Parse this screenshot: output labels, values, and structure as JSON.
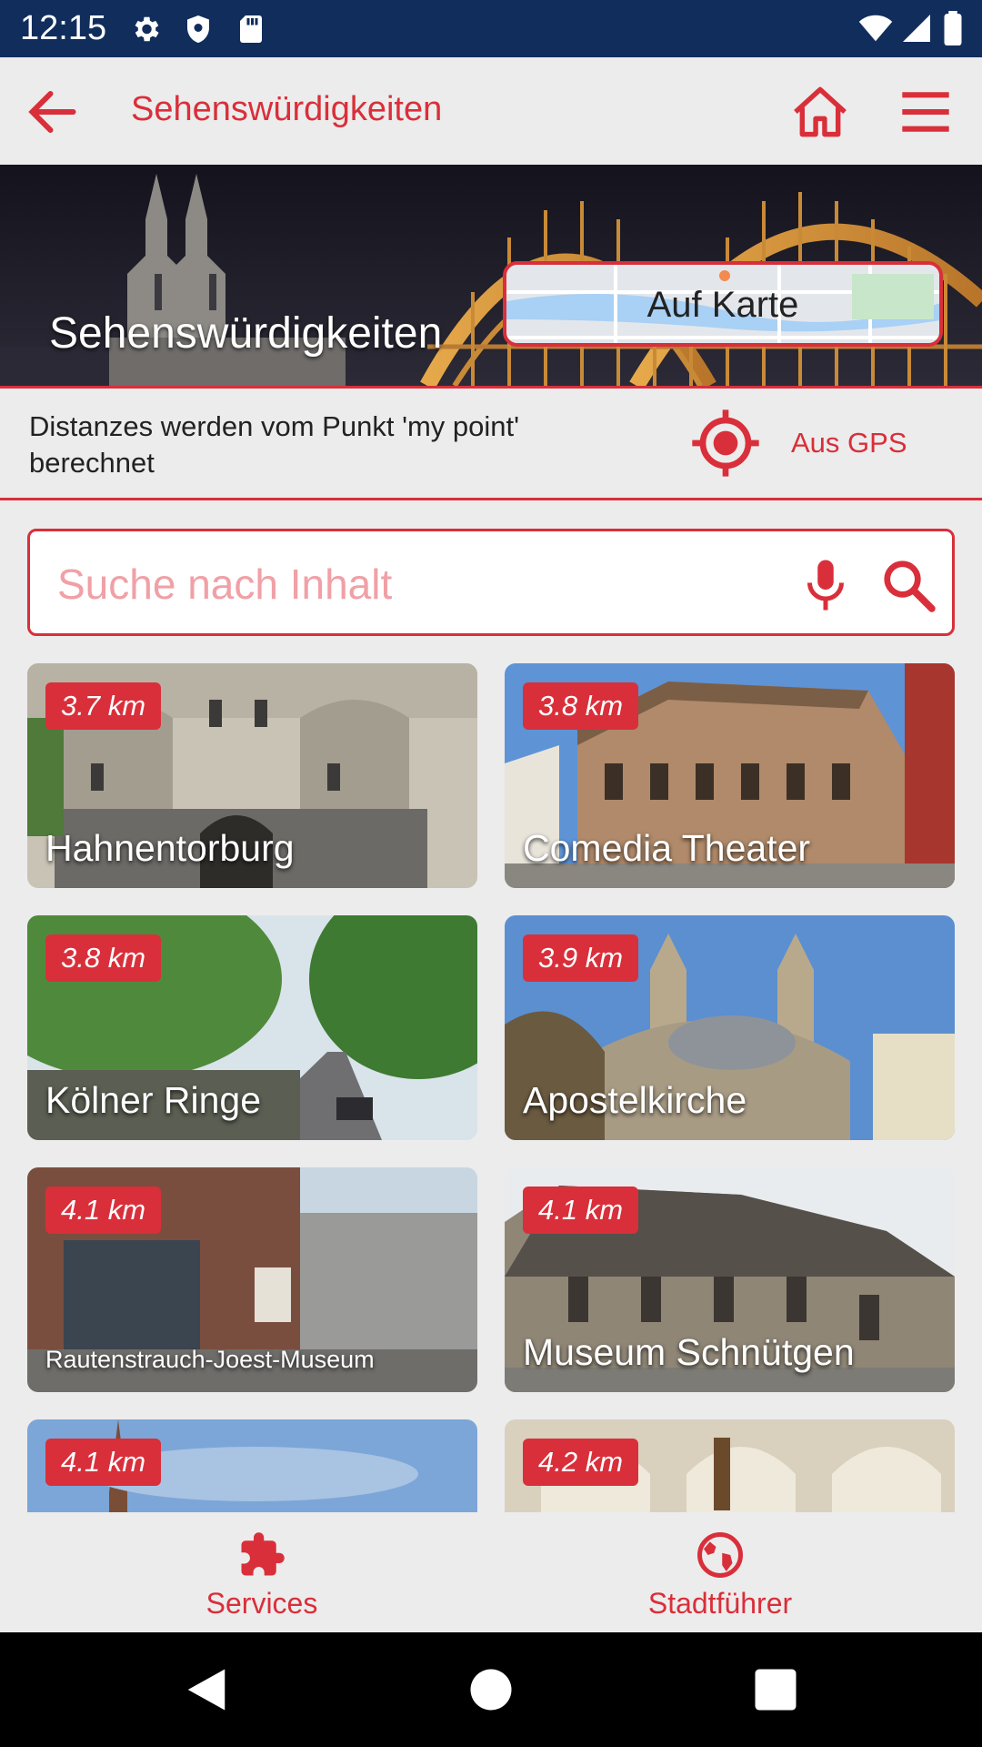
{
  "status_bar": {
    "time": "12:15"
  },
  "app_bar": {
    "title": "Sehenswürdigkeiten"
  },
  "hero": {
    "title": "Sehenswürdigkeiten",
    "map_button_label": "Auf Karte"
  },
  "info": {
    "distance_text": "Distanzes werden vom Punkt 'my point' berechnet",
    "gps_label": "Aus GPS"
  },
  "search": {
    "placeholder": "Suche nach Inhalt",
    "value": ""
  },
  "cards": [
    {
      "distance": "3.7 km",
      "name": "Hahnentorburg"
    },
    {
      "distance": "3.8 km",
      "name": "Comedia Theater"
    },
    {
      "distance": "3.8 km",
      "name": "Kölner Ringe"
    },
    {
      "distance": "3.9 km",
      "name": "Apostelkirche"
    },
    {
      "distance": "4.1 km",
      "name": "Rautenstrauch-Joest-Museum"
    },
    {
      "distance": "4.1 km",
      "name": "Museum Schnütgen"
    },
    {
      "distance": "4.1 km",
      "name": ""
    },
    {
      "distance": "4.2 km",
      "name": ""
    }
  ],
  "bottom_nav": {
    "services_label": "Services",
    "guide_label": "Stadtführer"
  },
  "colors": {
    "accent": "#d92f3a",
    "status_bar": "#102d5c",
    "background": "#ececec"
  }
}
